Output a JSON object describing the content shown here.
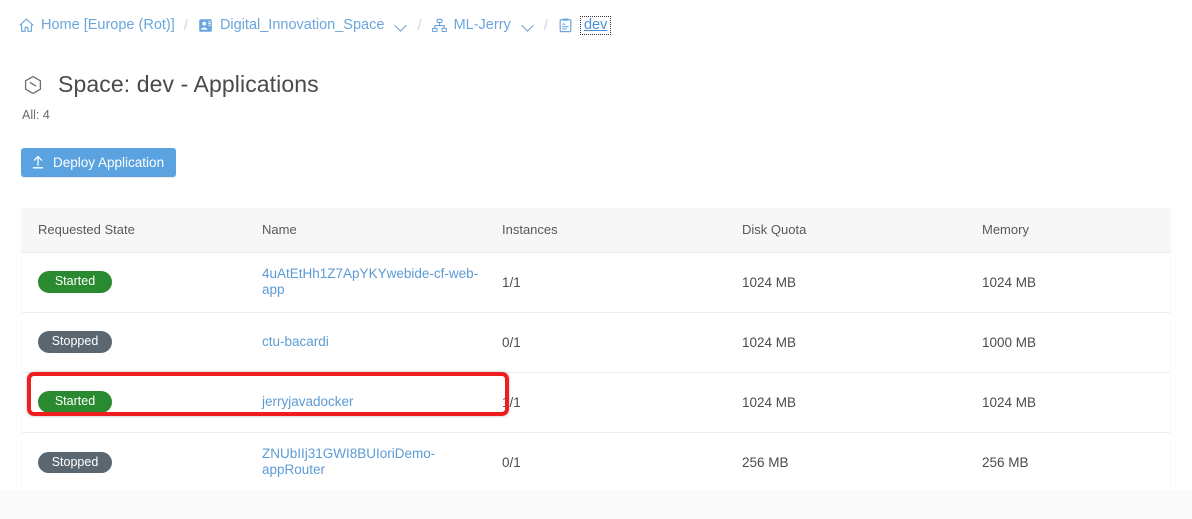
{
  "breadcrumb": {
    "separator": "/",
    "items": [
      {
        "label": "Home [Europe (Rot)]",
        "icon": "home-icon",
        "has_dropdown": false,
        "current": false
      },
      {
        "label": "Digital_Innovation_Space",
        "icon": "organization-icon",
        "has_dropdown": true,
        "current": false
      },
      {
        "label": "ML-Jerry",
        "icon": "org-tree-icon",
        "has_dropdown": true,
        "current": false
      },
      {
        "label": "dev",
        "icon": "space-list-icon",
        "has_dropdown": false,
        "current": true
      }
    ]
  },
  "header": {
    "icon": "space-hexagon-icon",
    "title": "Space: dev - Applications",
    "count_label": "All: 4"
  },
  "toolbar": {
    "deploy_label": "Deploy Application",
    "deploy_icon": "upload-icon",
    "deploy_color": "#5aa3e0"
  },
  "table": {
    "columns": [
      "Requested State",
      "Name",
      "Instances",
      "Disk Quota",
      "Memory"
    ],
    "rows": [
      {
        "state": "Started",
        "state_kind": "started",
        "name": "4uAtEtHh1Z7ApYKYwebide-cf-web-app",
        "instances": "1/1",
        "disk_quota": "1024 MB",
        "memory": "1024 MB"
      },
      {
        "state": "Stopped",
        "state_kind": "stopped",
        "name": "ctu-bacardi",
        "instances": "0/1",
        "disk_quota": "1024 MB",
        "memory": "1000 MB"
      },
      {
        "state": "Started",
        "state_kind": "started",
        "name": "jerryjavadocker",
        "instances": "1/1",
        "disk_quota": "1024 MB",
        "memory": "1024 MB"
      },
      {
        "state": "Stopped",
        "state_kind": "stopped",
        "name": "ZNUbIIj31GWI8BUIoriDemo-appRouter",
        "instances": "0/1",
        "disk_quota": "256 MB",
        "memory": "256 MB"
      }
    ]
  },
  "annotation": {
    "highlight_color": "#ef1d1d",
    "highlight_target_row": "jerryjavadocker"
  },
  "colors": {
    "link": "#5b9bd5",
    "started_badge": "#2a8a2f",
    "stopped_badge": "#5b6770",
    "header_bg": "#f7f7f7"
  }
}
